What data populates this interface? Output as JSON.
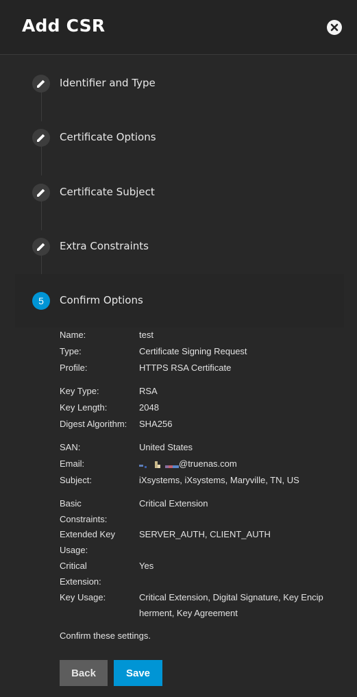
{
  "dialog": {
    "title": "Add CSR"
  },
  "steps": [
    {
      "label": "Identifier and Type",
      "icon": "pencil-icon"
    },
    {
      "label": "Certificate Options",
      "icon": "pencil-icon"
    },
    {
      "label": "Certificate Subject",
      "icon": "pencil-icon"
    },
    {
      "label": "Extra Constraints",
      "icon": "pencil-icon"
    },
    {
      "label": "Confirm Options",
      "number": "5"
    }
  ],
  "summary": {
    "name": {
      "key": "Name:",
      "value": "test"
    },
    "type": {
      "key": "Type:",
      "value": "Certificate Signing Request"
    },
    "profile": {
      "key": "Profile:",
      "value": "HTTPS RSA Certificate"
    },
    "key_type": {
      "key": "Key Type:",
      "value": "RSA"
    },
    "key_length": {
      "key": "Key Length:",
      "value": "2048"
    },
    "digest": {
      "key": "Digest Algorithm:",
      "value": "SHA256"
    },
    "san": {
      "key": "SAN:",
      "value": "United States"
    },
    "email": {
      "key": "Email:",
      "value": "@truenas.com"
    },
    "subject": {
      "key": "Subject:",
      "value": "iXsystems, iXsystems, Maryville, TN, US"
    },
    "basic_constraints": {
      "key": "Basic Constraints:",
      "value": "Critical Extension"
    },
    "extended_key_usage": {
      "key": "Extended Key Usage:",
      "value": "SERVER_AUTH, CLIENT_AUTH"
    },
    "critical_extension": {
      "key": "Critical Extension:",
      "value": "Yes"
    },
    "key_usage": {
      "key": "Key Usage:",
      "value": "Critical Extension, Digital Signature, Key Encipherment, Key Agreement"
    }
  },
  "confirm_text": "Confirm these settings.",
  "buttons": {
    "back": "Back",
    "save": "Save"
  },
  "colors": {
    "accent": "#0095d5",
    "background": "#282828",
    "secondary_button": "#5d5d5d"
  }
}
